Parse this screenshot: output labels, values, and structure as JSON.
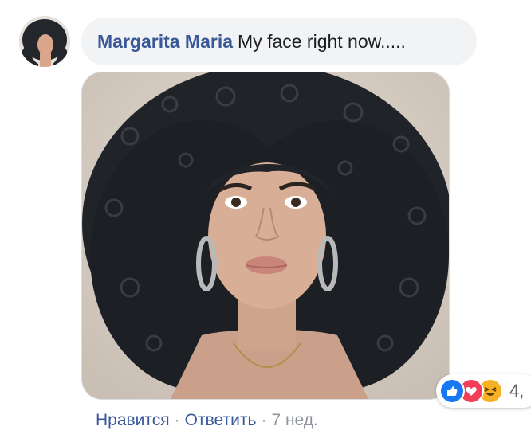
{
  "comment": {
    "author": "Margarita Maria",
    "text": "My face right now....."
  },
  "reactions": {
    "icons": [
      "like-icon",
      "love-icon",
      "haha-icon"
    ],
    "count": "4,"
  },
  "actions": {
    "like": "Нравится",
    "reply": "Ответить",
    "time": "7 нед.",
    "separator": "·"
  },
  "colors": {
    "link": "#385898",
    "bubble": "#f2f3f5",
    "like": "#1877f2",
    "love": "#f33e58",
    "haha": "#f7b125",
    "meta": "#90949c"
  }
}
